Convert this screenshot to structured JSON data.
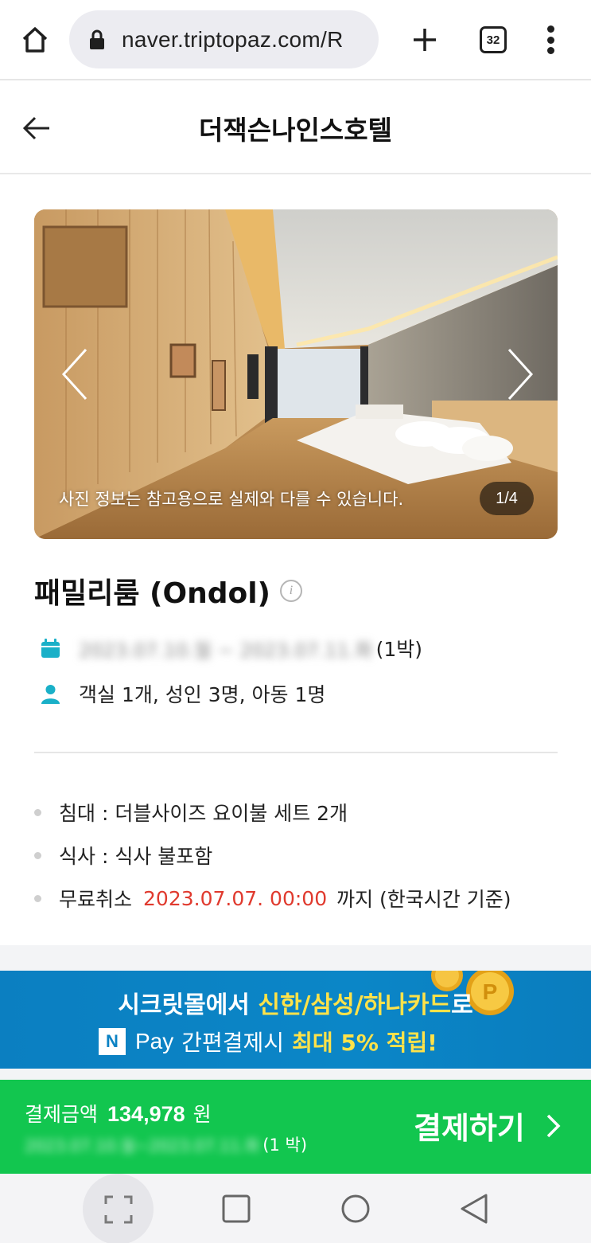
{
  "browser": {
    "url": "naver.triptopaz.com/R",
    "tab_count": "32"
  },
  "header": {
    "title": "더잭슨나인스호텔"
  },
  "carousel": {
    "note": "사진 정보는 참고용으로 실제와 다를 수 있습니다.",
    "counter": "1/4"
  },
  "room": {
    "name": "패밀리룸 (Ondol)",
    "dates_blurred": "2023.07.10.월 ~ 2023.07.11.화",
    "nights": "(1박)",
    "guests": "객실 1개, 성인 3명, 아동 1명",
    "details": [
      {
        "label": "침대 : 더블사이즈 요이불 세트 2개"
      },
      {
        "label": "식사 : 식사 불포함"
      },
      {
        "label": "무료취소",
        "highlight": "2023.07.07. 00:00",
        "suffix": "까지 (한국시간 기준)"
      }
    ]
  },
  "banner": {
    "line1_prefix": "시크릿몰에서 ",
    "line1_highlight": "신한/삼성/하나카드",
    "line1_suffix": "로",
    "npay_badge": "N",
    "pay_word": "Pay",
    "line2_text": "간편결제시",
    "line2_highlight": "최대 5% 적립!"
  },
  "payment": {
    "label": "결제금액",
    "amount": "134,978",
    "unit": "원",
    "dates_blurred": "2023.07.10.월~2023.07.11.화",
    "nights": "(1 박)",
    "button_label": "결제하기"
  },
  "colors": {
    "accent_teal": "#1ab0c8",
    "cancel_red": "#e03a2e",
    "pay_green": "#12c64f",
    "banner_blue": "#0b82c4",
    "banner_yellow": "#ffe249"
  },
  "icons": {
    "home": "home-icon",
    "lock": "lock-icon",
    "new_tab": "plus-icon",
    "menu": "more-vert-icon",
    "back": "arrow-left-icon",
    "calendar": "calendar-icon",
    "person": "person-icon",
    "info": "info-icon"
  }
}
